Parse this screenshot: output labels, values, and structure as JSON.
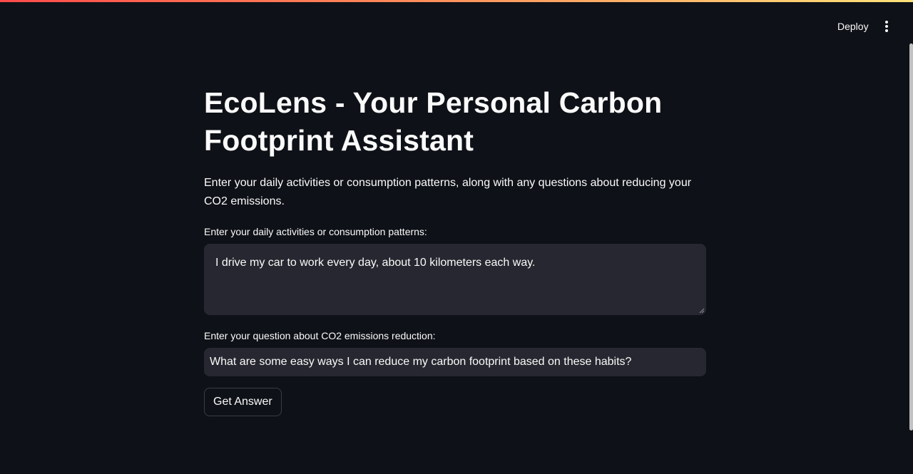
{
  "header": {
    "deploy_label": "Deploy",
    "menu_icon": "vertical-ellipsis-icon"
  },
  "main": {
    "title": "EcoLens - Your Personal Carbon Footprint Assistant",
    "description": "Enter your daily activities or consumption patterns, along with any questions about reducing your CO2 emissions.",
    "activities_label": "Enter your daily activities or consumption patterns:",
    "activities_value": "I drive my car to work every day, about 10 kilometers each way.",
    "question_label": "Enter your question about CO2 emissions reduction:",
    "question_value": "What are some easy ways I can reduce my carbon footprint based on these habits?",
    "submit_label": "Get Answer"
  },
  "colors": {
    "background": "#0e1117",
    "input_background": "#262730",
    "text": "#fafafa",
    "accent_gradient_start": "#ff4b4b",
    "accent_gradient_end": "#ffe27a"
  }
}
